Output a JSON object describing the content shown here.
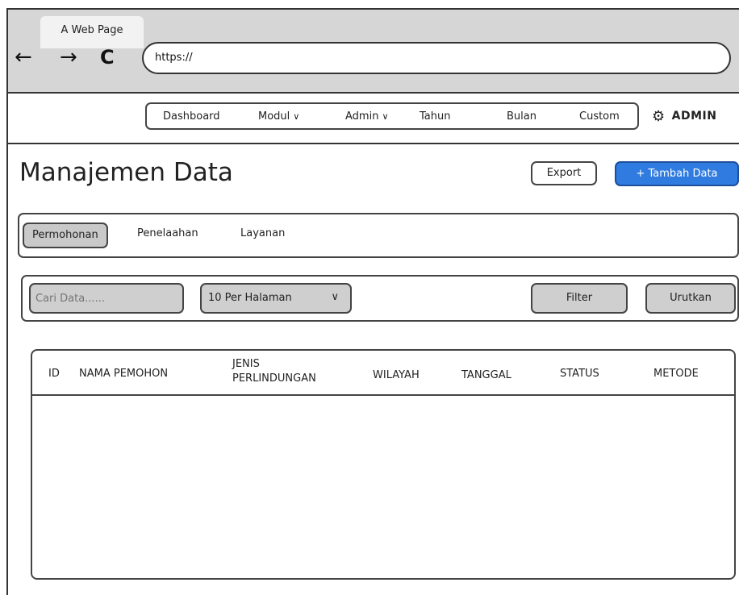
{
  "browser": {
    "tab_title": "A Web Page",
    "back_icon": "←",
    "forward_icon": "→",
    "reload_icon": "C",
    "url": "https://"
  },
  "topnav": {
    "items": [
      {
        "label": "Dashboard",
        "dropdown": false
      },
      {
        "label": "Modul",
        "dropdown": true
      },
      {
        "label": "Admin",
        "dropdown": true
      },
      {
        "label": "Tahun",
        "dropdown": false
      },
      {
        "label": "Bulan",
        "dropdown": false
      },
      {
        "label": "Custom",
        "dropdown": false
      }
    ],
    "chevron": "∨",
    "user_icon": "⚙",
    "user_label": "ADMIN"
  },
  "page": {
    "title": "Manajemen Data",
    "export_label": "Export",
    "add_label": "+ Tambah Data",
    "accent_color": "#2f7be0"
  },
  "tabs": [
    {
      "label": "Permohonan",
      "active": true
    },
    {
      "label": "Penelaahan",
      "active": false
    },
    {
      "label": "Layanan",
      "active": false
    }
  ],
  "filters": {
    "search_placeholder": "Cari Data......",
    "per_page": "10 Per Halaman",
    "per_page_chevron": "∨",
    "filter_label": "Filter",
    "sort_label": "Urutkan"
  },
  "table": {
    "columns": [
      [
        "ID"
      ],
      [
        "NAMA PEMOHON"
      ],
      [
        "JENIS",
        "PERLINDUNGAN"
      ],
      [
        "WILAYAH"
      ],
      [
        "TANGGAL"
      ],
      [
        "STATUS"
      ],
      [
        "METODE"
      ]
    ],
    "rows": []
  }
}
